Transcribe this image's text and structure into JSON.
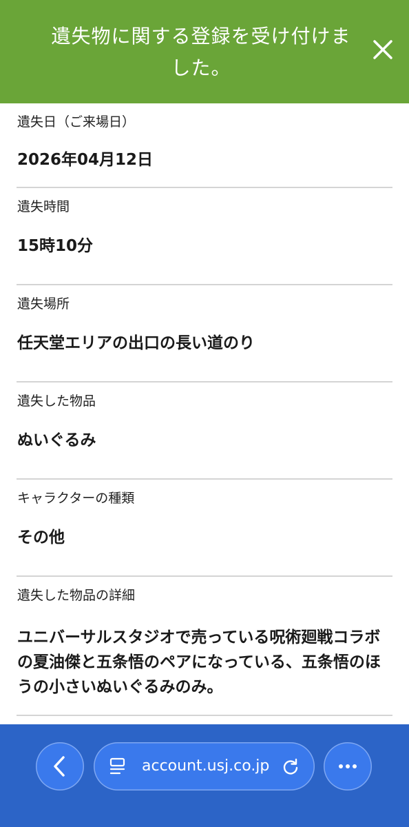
{
  "banner": {
    "message": "遺失物に関する登録を受け付けました。",
    "color": "#6aa538",
    "close_icon": "close-icon"
  },
  "fields": [
    {
      "label": "遺失日（ご来場日）",
      "value": "2026年04月12日"
    },
    {
      "label": "遺失時間",
      "value": "15時10分"
    },
    {
      "label": "遺失場所",
      "value": "任天堂エリアの出口の長い道のり"
    },
    {
      "label": "遺失した物品",
      "value": "ぬいぐるみ"
    },
    {
      "label": "キャラクターの種類",
      "value": "その他"
    },
    {
      "label": "遺失した物品の詳細",
      "value": "ユニバーサルスタジオで売っている呪術廻戦コラボの夏油傑と五条悟のペアになっている、五条悟のほうの小さいぬいぐるみのみ。"
    }
  ],
  "browser": {
    "url": "account.usj.co.jp",
    "bar_color": "#2c64c7",
    "back_icon": "chevron-left-icon",
    "tabs_icon": "tabs-icon",
    "reload_icon": "reload-icon",
    "more_icon": "more-icon"
  }
}
